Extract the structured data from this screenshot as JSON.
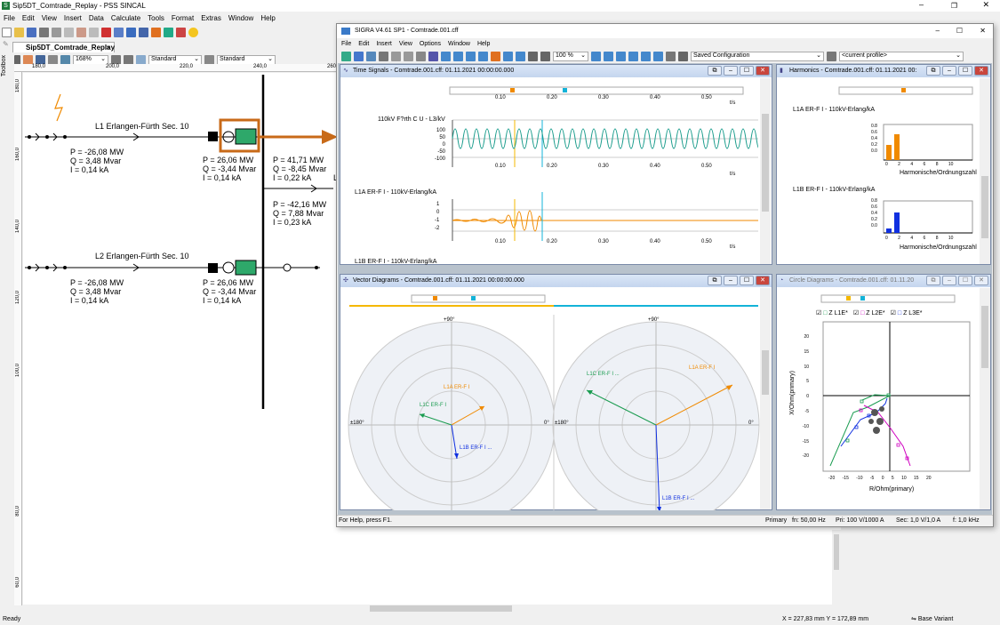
{
  "app": {
    "title": "Sip5DT_Comtrade_Replay - PSS SINCAL",
    "menu": [
      "File",
      "Edit",
      "View",
      "Insert",
      "Data",
      "Calculate",
      "Tools",
      "Format",
      "Extras",
      "Window",
      "Help"
    ],
    "tab": "Sip5DT_Comtrade_Replay",
    "zoom": "168%",
    "style1": "Standard",
    "style2": "Standard",
    "toolbox": "Toolbox",
    "status": "Ready",
    "coords": "X = 227,83  mm  Y = 172,89  mm",
    "variant": "Base Variant"
  },
  "ruler": {
    "top": [
      "180,0",
      "200,0",
      "220,0",
      "240,0",
      "260,0"
    ],
    "left": [
      "180,0",
      "160,0",
      "140,0",
      "120,0",
      "100,0",
      "80,0",
      "60,0"
    ]
  },
  "grid": {
    "line1": "L1 Erlangen-Fürth Sec. 10",
    "line2": "L2 Erlangen-Fürth Sec. 10",
    "l1_left": [
      "P = -26,08 MW",
      "Q = 3,48 Mvar",
      "I = 0,14 kA"
    ],
    "l1_right": [
      "P = 26,06 MW",
      "Q = -3,44 Mvar",
      "I = 0,14 kA"
    ],
    "l1_bus": [
      "P = 41,71 MW",
      "Q = -8,45 Mvar",
      "I = 0,22 kA"
    ],
    "bus2": [
      "P = -42,16 MW",
      "Q = 7,88 Mvar",
      "I = 0,23 kA"
    ],
    "l2_left": [
      "P = -26,08 MW",
      "Q = 3,48 Mvar",
      "I = 0,14 kA"
    ],
    "l2_right": [
      "P = 26,06 MW",
      "Q = -3,44 Mvar",
      "I = 0,14 kA"
    ],
    "cut": "L"
  },
  "sigra": {
    "title": "SIGRA V4.61 SP1 - Comtrade.001.cff",
    "menu": [
      "File",
      "Edit",
      "Insert",
      "View",
      "Options",
      "Window",
      "Help"
    ],
    "zoom": "100 %",
    "config": "Saved Configuration",
    "profile": "<current profile>",
    "status_left": "For Help, press F1.",
    "status_right": [
      "Primary",
      "fn: 50,00 Hz",
      "Pri: 100 V/1000 A",
      "Sec: 1,0 V/1,0 A",
      "f: 1,0 kHz"
    ]
  },
  "time_signals": {
    "title": "Time Signals - Comtrade.001.cff: 01.11.2021 00:00:00.000",
    "xticks": [
      "0.10",
      "0.20",
      "0.30",
      "0.40",
      "0.50"
    ],
    "unit": "t/s",
    "s1": "110kV F?rth C U - L3/kV",
    "s1_ticks": [
      "100",
      "50",
      "0",
      "-50",
      "-100"
    ],
    "s2": "L1A ER-F I - 110kV-Erlang/kA",
    "s2_ticks": [
      "1",
      "0",
      "-1",
      "-2"
    ],
    "s3": "L1B ER-F I - 110kV-Erlang/kA"
  },
  "harmonics": {
    "title": "Harmonics - Comtrade.001.cff: 01.11.2021 00:",
    "p1": "L1A ER-F I - 110kV-Erlang/kA",
    "p2": "L1B ER-F I - 110kV-Erlang/kA",
    "yticks": [
      "0.8",
      "0.6",
      "0.4",
      "0.2",
      "0.0"
    ],
    "xticks": [
      "0",
      "2",
      "4",
      "6",
      "8",
      "10"
    ],
    "xlabel": "Harmonische/Ordnungszahl",
    "bars1": [
      0.42,
      0.7,
      0.02
    ],
    "bars2": [
      0.12,
      0.55,
      0.02
    ]
  },
  "vector": {
    "title": "Vector Diagrams - Comtrade.001.cff: 01.11.2021 00:00:00.000",
    "top": "+90°",
    "left": "±180°",
    "right": "0°",
    "labels": [
      "L1A ER-F I",
      "L1C ER-F I",
      "L1B ER-F I ..."
    ],
    "labels2": [
      "L1A ER-F I",
      "L1C ER-F I ...",
      "L1B ER-F I ..."
    ]
  },
  "circle": {
    "title": "Circle Diagrams - Comtrade.001.cff: 01.11.20",
    "legend": [
      "Z L1E*",
      "Z L2E*",
      "Z L3E*"
    ],
    "yticks": [
      "20",
      "15",
      "10",
      "5",
      "0",
      "-5",
      "-10",
      "-15",
      "-20"
    ],
    "xticks": [
      "-20",
      "-15",
      "-10",
      "-5",
      "0",
      "5",
      "10",
      "15",
      "20"
    ],
    "ylabel": "X/Ohm(primary)",
    "xlabel": "R/Ohm(primary)"
  },
  "colors": {
    "orange": "#f08a00",
    "teal": "#1a9c8c",
    "green": "#1a9c50",
    "cyan": "#13b3d8",
    "blue": "#1030e0",
    "magenta": "#d000c0",
    "bus": "#2ea86a"
  }
}
